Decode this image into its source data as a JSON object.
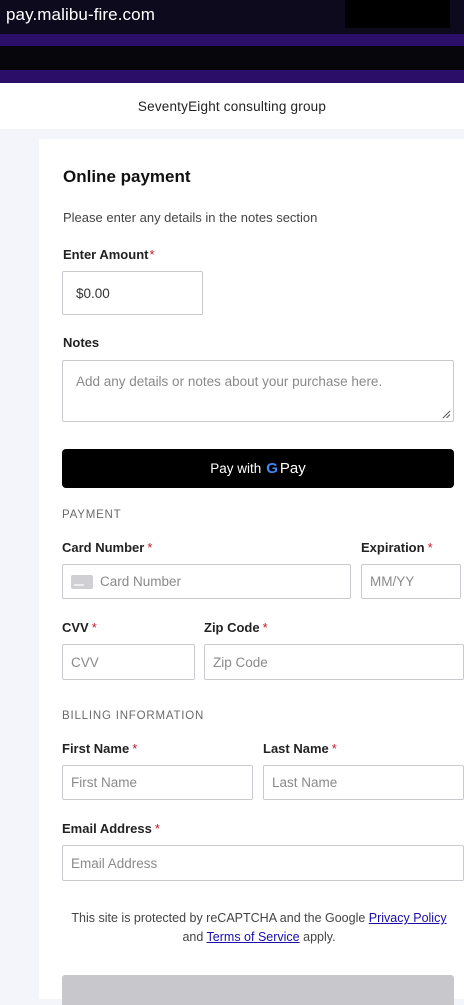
{
  "browser": {
    "url": "pay.malibu-fire.com"
  },
  "merchant": {
    "name": "SeventyEight consulting group"
  },
  "form": {
    "title": "Online payment",
    "subtitle": "Please enter any details in the notes section",
    "amount": {
      "label": "Enter Amount",
      "required": "*",
      "value": "$0.00"
    },
    "notes": {
      "label": "Notes",
      "placeholder": "Add any details or notes about your purchase here."
    },
    "gpay": {
      "prefix": "Pay with",
      "g": "G",
      "pay": "Pay"
    },
    "payment_section": "PAYMENT",
    "card_number": {
      "label": "Card Number",
      "required": "*",
      "placeholder": "Card Number"
    },
    "expiration": {
      "label": "Expiration",
      "required": "*",
      "placeholder": "MM/YY"
    },
    "cvv": {
      "label": "CVV",
      "required": "*",
      "placeholder": "CVV"
    },
    "zip": {
      "label": "Zip Code",
      "required": "*",
      "placeholder": "Zip Code"
    },
    "billing_section": "BILLING INFORMATION",
    "first_name": {
      "label": "First Name",
      "required": "*",
      "placeholder": "First Name"
    },
    "last_name": {
      "label": "Last Name",
      "required": "*",
      "placeholder": "Last Name"
    },
    "email": {
      "label": "Email Address",
      "required": "*",
      "placeholder": "Email Address"
    },
    "legal": {
      "text1": "This site is protected by reCAPTCHA and the Google",
      "privacy": "Privacy Policy",
      "and": "and",
      "terms": "Terms of Service",
      "apply": "apply."
    }
  },
  "colors": {
    "banner": "#2b0e68",
    "required": "#c0162c",
    "link": "#1a0dab",
    "gpay_bg": "#000000"
  },
  "icons": [
    "credit-card-icon",
    "google-g-icon",
    "resize-grip-icon"
  ]
}
